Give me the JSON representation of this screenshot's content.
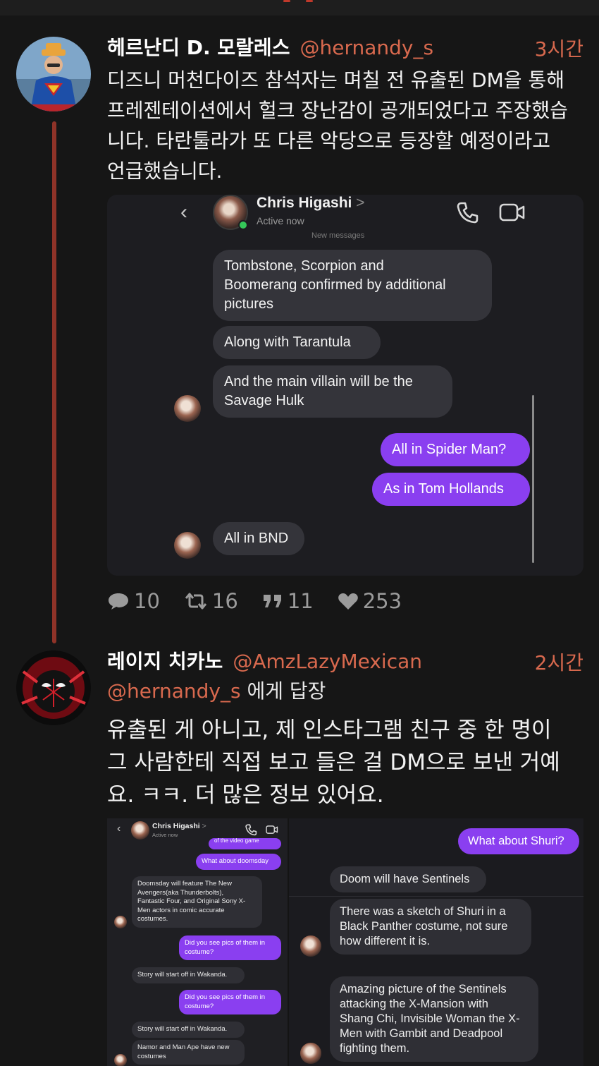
{
  "post1": {
    "author_name": "헤르난디 D. 모랄레스",
    "handle": "@hernandy_s",
    "time": "3시간",
    "text": "디즈니 머천다이즈 참석자는 며칠 전 유출된 DM을 통해\n프레젠테이션에서 헐크 장난감이 공개되었다고 주장했습\n니다. 타란툴라가 또 다른 악당으로 등장할 예정이라고\n언급했습니다.",
    "actions": {
      "replies": "10",
      "retweets": "16",
      "quotes": "11",
      "likes": "253"
    }
  },
  "dm_screenshot1": {
    "contact_name": "Chris Higashi",
    "chevron": ">",
    "status": "Active now",
    "new_messages_divider": "New messages",
    "messages": [
      "Tombstone, Scorpion and\nBoomerang confirmed by additional\npictures",
      "Along with Tarantula",
      "And the main villain will be the\nSavage Hulk",
      "All in Spider Man?",
      "As in Tom Hollands",
      "All in BND"
    ]
  },
  "post2": {
    "author_name": "레이지 치카노",
    "handle": "@AmzLazyMexican",
    "time": "2시간",
    "reply_handle": "@hernandy_s",
    "reply_suffix": " 에게 답장",
    "text": "유출된 게 아니고, 제 인스타그램 친구 중 한 명이\n그 사람한테 직접 보고 들은 걸 DM으로 보낸 거예\n요. ㅋㅋ. 더 많은 정보 있어요."
  },
  "dm_screenshot2": {
    "contact_name": "Chris Higashi",
    "chevron": ">",
    "status": "Active now",
    "left_messages": [
      "of the video game",
      "What about doomsday",
      "Doomsday will feature The New\nAvengers(aka Thunderbolts),\nFantastic Four, and Original Sony X-\nMen actors in comic accurate\ncostumes.",
      "Did you see pics of them in\ncostume?",
      "Story will start off in Wakanda.",
      "Did you see pics of them in\ncostume?",
      "Story will start off in Wakanda.",
      "Namor and Man Ape have new\ncostumes"
    ],
    "right_messages": [
      "What about Shuri?",
      "Doom will have Sentinels",
      "There was a sketch of Shuri in a\nBlack Panther costume, not sure\nhow different it is.",
      "Amazing picture of the Sentinels\nattacking the X-Mansion with\nShang Chi, Invisible Woman the X-\nMen with Gambit and Deadpool\nfighting them."
    ]
  },
  "colors": {
    "accent": "#d8694e",
    "thread_line": "#8f3328",
    "bubble_out": "#8a3ff0",
    "bubble_in": "#34343a"
  }
}
